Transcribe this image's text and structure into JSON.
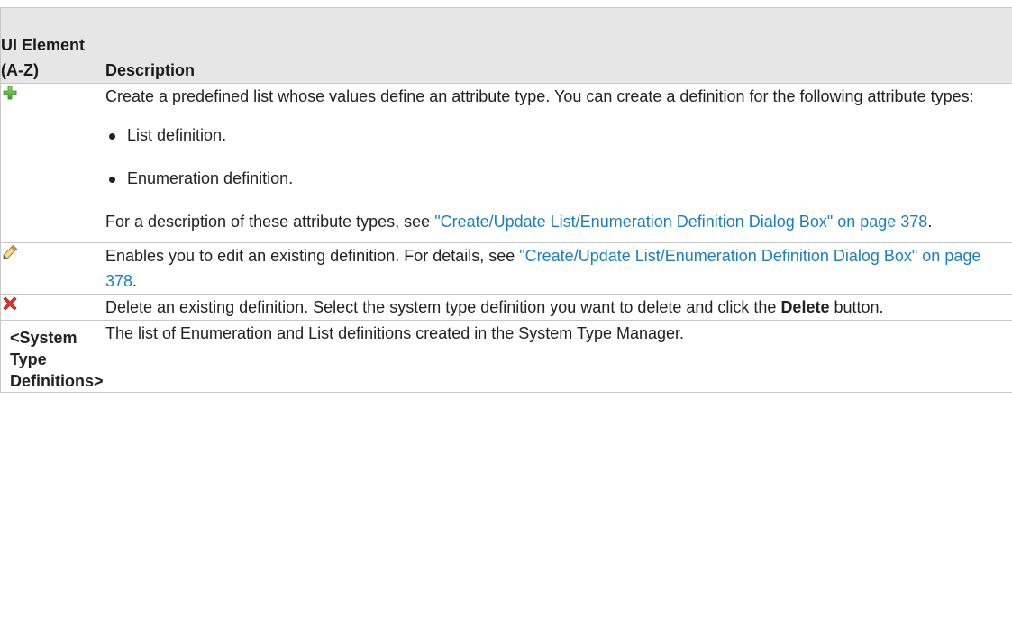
{
  "table": {
    "headers": {
      "element": "UI Element (A-Z)",
      "description": "Description"
    },
    "rows": {
      "add": {
        "icon": "green-plus-icon",
        "intro": "Create a predefined list whose values define an attribute type. You can create a definition for the following attribute types:",
        "bullets": [
          "List definition.",
          "Enumeration definition."
        ],
        "after_prefix": "For a description of these attribute types, see ",
        "after_link": "\"Create/Update List/Enumeration Definition Dialog Box\" on page 378",
        "after_suffix": "."
      },
      "edit": {
        "icon": "pencil-icon",
        "prefix": "Enables you to edit an existing definition. For details, see ",
        "link": "\"Create/Update List/Enumeration Definition Dialog Box\" on page 378",
        "suffix": "."
      },
      "delete": {
        "icon": "red-x-icon",
        "prefix": "Delete an existing definition. Select the system type definition you want to delete and click the ",
        "bold": "Delete",
        "suffix": " button."
      },
      "system_types": {
        "element": "<System Type Definitions>",
        "description": "The list of Enumeration and List definitions created in the System Type Manager."
      }
    }
  },
  "colors": {
    "header_bg": "#e6e6e6",
    "border": "#c8c8c8",
    "link": "#1a7fc2"
  }
}
